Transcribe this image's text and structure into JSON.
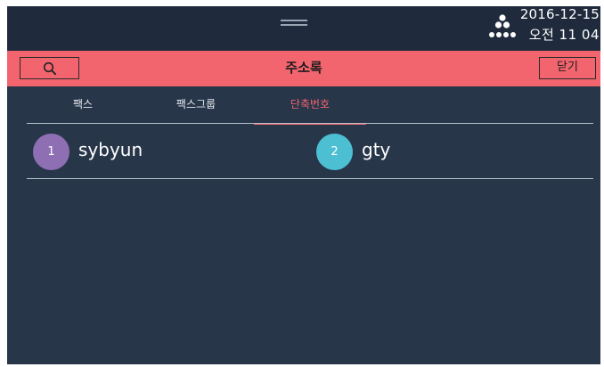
{
  "status_bar": {
    "date": "2016-12-15",
    "time": "오전 11 04"
  },
  "header": {
    "title": "주소록",
    "close_label": "닫기"
  },
  "tabs": [
    {
      "label": "팩스",
      "active": false
    },
    {
      "label": "팩스그룹",
      "active": false
    },
    {
      "label": "단축번호",
      "active": true
    }
  ],
  "contacts": [
    {
      "number": "1",
      "name": "sybyun",
      "color": "#8f6fb4"
    },
    {
      "number": "2",
      "name": "gty",
      "color": "#4cbfd3"
    }
  ],
  "colors": {
    "accent": "#f2646e",
    "background": "#28364a",
    "status_bar": "#1f2b3c"
  },
  "icons": {
    "search": "search-icon",
    "logo": "dots-logo-icon"
  }
}
